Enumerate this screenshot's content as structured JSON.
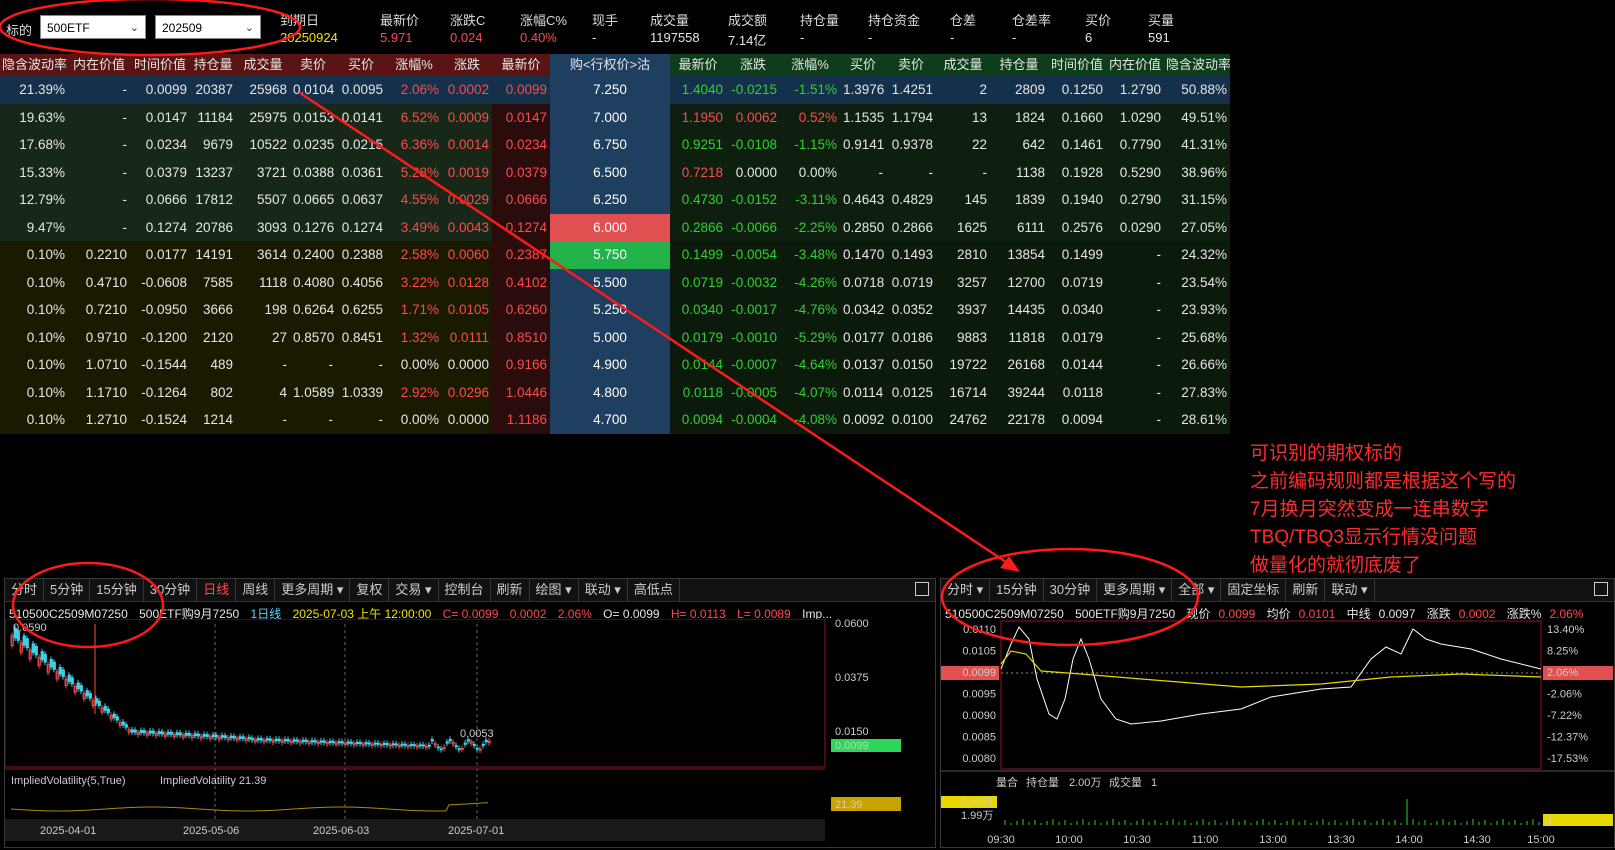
{
  "header": {
    "underlying_label": "标的",
    "underlying_value": "500ETF",
    "month_value": "202509",
    "columns": [
      {
        "label": "到期日",
        "value": "20250924",
        "color": "#f2e500"
      },
      {
        "label": "最新价",
        "value": "5.971",
        "color": "#ff4a4a"
      },
      {
        "label": "涨跌C",
        "value": "0.024",
        "color": "#ff4a4a"
      },
      {
        "label": "涨幅C%",
        "value": "0.40%",
        "color": "#ff4a4a"
      },
      {
        "label": "现手",
        "value": "-",
        "color": "#e6e6e6"
      },
      {
        "label": "成交量",
        "value": "1197558",
        "color": "#e6e6e6"
      },
      {
        "label": "成交额",
        "value": "7.14亿",
        "color": "#e6e6e6"
      },
      {
        "label": "持仓量",
        "value": "-",
        "color": "#e6e6e6"
      },
      {
        "label": "持仓资金",
        "value": "-",
        "color": "#e6e6e6"
      },
      {
        "label": "仓差",
        "value": "-",
        "color": "#e6e6e6"
      },
      {
        "label": "仓差率",
        "value": "-",
        "color": "#e6e6e6"
      },
      {
        "label": "买价",
        "value": "6",
        "color": "#e6e6e6"
      },
      {
        "label": "买量",
        "value": "591",
        "color": "#e6e6e6"
      }
    ]
  },
  "tquote": {
    "call_headers": [
      "隐含波动率",
      "内在价值",
      "时间价值",
      "持仓量",
      "成交量",
      "卖价",
      "买价",
      "涨幅%",
      "涨跌",
      "最新价"
    ],
    "strike_header": "购<行权价>沽",
    "put_headers": [
      "最新价",
      "涨跌",
      "涨幅%",
      "买价",
      "卖价",
      "成交量",
      "持仓量",
      "时间价值",
      "内在价值",
      "隐含波动率"
    ],
    "rows": [
      {
        "call": [
          "21.39%",
          "-",
          "0.0099",
          "20387",
          "25968",
          "0.0104",
          "0.0095",
          "2.06%",
          "0.0002",
          "0.0099"
        ],
        "strike": "7.250",
        "put": [
          "1.4040",
          "-0.0215",
          "-1.51%",
          "1.3976",
          "1.4251",
          "2",
          "2809",
          "0.1250",
          "1.2790",
          "50.88%"
        ]
      },
      {
        "call": [
          "19.63%",
          "-",
          "0.0147",
          "11184",
          "25975",
          "0.0153",
          "0.0141",
          "6.52%",
          "0.0009",
          "0.0147"
        ],
        "strike": "7.000",
        "put": [
          "1.1950",
          "0.0062",
          "0.52%",
          "1.1535",
          "1.1794",
          "13",
          "1824",
          "0.1660",
          "1.0290",
          "49.51%"
        ]
      },
      {
        "call": [
          "17.68%",
          "-",
          "0.0234",
          "9679",
          "10522",
          "0.0235",
          "0.0215",
          "6.36%",
          "0.0014",
          "0.0234"
        ],
        "strike": "6.750",
        "put": [
          "0.9251",
          "-0.0108",
          "-1.15%",
          "0.9141",
          "0.9378",
          "22",
          "642",
          "0.1461",
          "0.7790",
          "41.31%"
        ]
      },
      {
        "call": [
          "15.33%",
          "-",
          "0.0379",
          "13237",
          "3721",
          "0.0388",
          "0.0361",
          "5.28%",
          "0.0019",
          "0.0379"
        ],
        "strike": "6.500",
        "put": [
          "0.7218",
          "0.0000",
          "0.00%",
          "-",
          "-",
          "-",
          "1138",
          "0.1928",
          "0.5290",
          "38.96%"
        ]
      },
      {
        "call": [
          "12.79%",
          "-",
          "0.0666",
          "17812",
          "5507",
          "0.0665",
          "0.0637",
          "4.55%",
          "0.0029",
          "0.0666"
        ],
        "strike": "6.250",
        "put": [
          "0.4730",
          "-0.0152",
          "-3.11%",
          "0.4643",
          "0.4829",
          "145",
          "1839",
          "0.1940",
          "0.2790",
          "31.15%"
        ]
      },
      {
        "call": [
          "9.47%",
          "-",
          "0.1274",
          "20786",
          "3093",
          "0.1276",
          "0.1274",
          "3.49%",
          "0.0043",
          "0.1274"
        ],
        "strike": "6.000",
        "put": [
          "0.2866",
          "-0.0066",
          "-2.25%",
          "0.2850",
          "0.2866",
          "1625",
          "6111",
          "0.2576",
          "0.0290",
          "27.05%"
        ]
      },
      {
        "call": [
          "0.10%",
          "0.2210",
          "0.0177",
          "14191",
          "3614",
          "0.2400",
          "0.2388",
          "2.58%",
          "0.0060",
          "0.2387"
        ],
        "strike": "5.750",
        "put": [
          "0.1499",
          "-0.0054",
          "-3.48%",
          "0.1470",
          "0.1493",
          "2810",
          "13854",
          "0.1499",
          "-",
          "24.32%"
        ]
      },
      {
        "call": [
          "0.10%",
          "0.4710",
          "-0.0608",
          "7585",
          "1118",
          "0.4080",
          "0.4056",
          "3.22%",
          "0.0128",
          "0.4102"
        ],
        "strike": "5.500",
        "put": [
          "0.0719",
          "-0.0032",
          "-4.26%",
          "0.0718",
          "0.0719",
          "3257",
          "12700",
          "0.0719",
          "-",
          "23.54%"
        ]
      },
      {
        "call": [
          "0.10%",
          "0.7210",
          "-0.0950",
          "3666",
          "198",
          "0.6264",
          "0.6255",
          "1.71%",
          "0.0105",
          "0.6260"
        ],
        "strike": "5.250",
        "put": [
          "0.0340",
          "-0.0017",
          "-4.76%",
          "0.0342",
          "0.0352",
          "3937",
          "14435",
          "0.0340",
          "-",
          "23.93%"
        ]
      },
      {
        "call": [
          "0.10%",
          "0.9710",
          "-0.1200",
          "2120",
          "27",
          "0.8570",
          "0.8451",
          "1.32%",
          "0.0111",
          "0.8510"
        ],
        "strike": "5.000",
        "put": [
          "0.0179",
          "-0.0010",
          "-5.29%",
          "0.0177",
          "0.0186",
          "9883",
          "11818",
          "0.0179",
          "-",
          "25.68%"
        ]
      },
      {
        "call": [
          "0.10%",
          "1.0710",
          "-0.1544",
          "489",
          "-",
          "-",
          "-",
          "0.00%",
          "0.0000",
          "0.9166"
        ],
        "strike": "4.900",
        "put": [
          "0.0144",
          "-0.0007",
          "-4.64%",
          "0.0137",
          "0.0150",
          "19722",
          "26168",
          "0.0144",
          "-",
          "26.66%"
        ]
      },
      {
        "call": [
          "0.10%",
          "1.1710",
          "-0.1264",
          "802",
          "4",
          "1.0589",
          "1.0339",
          "2.92%",
          "0.0296",
          "1.0446"
        ],
        "strike": "4.800",
        "put": [
          "0.0118",
          "-0.0005",
          "-4.07%",
          "0.0114",
          "0.0125",
          "16714",
          "39244",
          "0.0118",
          "-",
          "27.83%"
        ]
      },
      {
        "call": [
          "0.10%",
          "1.2710",
          "-0.1524",
          "1214",
          "-",
          "-",
          "-",
          "0.00%",
          "0.0000",
          "1.1186"
        ],
        "strike": "4.700",
        "put": [
          "0.0094",
          "-0.0004",
          "-4.08%",
          "0.0092",
          "0.0100",
          "24762",
          "22178",
          "0.0094",
          "-",
          "28.61%"
        ]
      }
    ]
  },
  "annotation": {
    "lines": [
      "可识别的期权标的",
      "之前编码规则都是根据这个写的",
      "7月换月突然变成一连串数字",
      "TBQ/TBQ3显示行情没问题",
      "做量化的就彻底废了"
    ]
  },
  "kline_panel": {
    "toolbar": [
      "分时",
      "5分钟",
      "15分钟",
      "30分钟",
      "日线",
      "周线",
      "更多周期 ▾",
      "复权",
      "交易 ▾",
      "控制台",
      "刷新",
      "绘图 ▾",
      "联动 ▾",
      "高低点"
    ],
    "active_tab": "日线",
    "info": {
      "code": "510500C2509M07250",
      "name": "500ETF购9月7250",
      "period": "1日线",
      "datetime": "2025-07-03 上午 12:00:00",
      "c": "C= 0.0099",
      "chg": "0.0002",
      "pct": "2.06%",
      "o": "O= 0.0099",
      "h": "H= 0.0113",
      "l": "L= 0.0089",
      "imp": "Imp..."
    },
    "high_label": "0.0590",
    "low_label": "0.0053",
    "y_ticks": [
      "0.0600",
      "0.0375",
      "0.0150"
    ],
    "last_price": "0.0099",
    "iv_label": "ImpliedVolatility(5,True)",
    "iv_value_label": "ImpliedVolatility 21.39",
    "iv_last": "21.39",
    "x_ticks": [
      "2025-04-01",
      "2025-05-06",
      "2025-06-03",
      "2025-07-01"
    ]
  },
  "intraday_panel": {
    "toolbar": [
      "分时 ▾",
      "15分钟",
      "30分钟",
      "更多周期 ▾",
      "全部 ▾",
      "固定坐标",
      "刷新",
      "联动 ▾"
    ],
    "info": {
      "code": "510500C2509M07250",
      "name": "500ETF购9月7250",
      "price_label": "现价",
      "price": "0.0099",
      "avg_label": "均价",
      "avg": "0.0101",
      "mid_label": "中线",
      "mid": "0.0097",
      "chg_label": "涨跌",
      "chg": "0.0002",
      "pct_label": "涨跌%",
      "pct": "2.06%"
    },
    "y_left": [
      "0.0110",
      "0.0105",
      "0.0099",
      "0.0095",
      "0.0090",
      "0.0085",
      "0.0080"
    ],
    "y_right": [
      "13.40%",
      "8.25%",
      "2.06%",
      "-2.06%",
      "-7.22%",
      "-12.37%",
      "-17.53%"
    ],
    "vol_labels": {
      "title": "量合",
      "oi_label": "持仓量",
      "oi_value": "2.00万",
      "vol_label": "成交量",
      "vol_value": "1"
    },
    "vol_axis": [
      "2.00万",
      "1.99万"
    ],
    "vol_right": "1",
    "x_ticks": [
      "09:30",
      "10:00",
      "10:30",
      "11:00",
      "13:00",
      "13:30",
      "14:00",
      "14:30",
      "15:00"
    ]
  },
  "colors": {
    "up": "#ff4a4a",
    "down": "#2fd12f",
    "accent": "#f2e500",
    "strike_bg": "#1f3f60"
  }
}
